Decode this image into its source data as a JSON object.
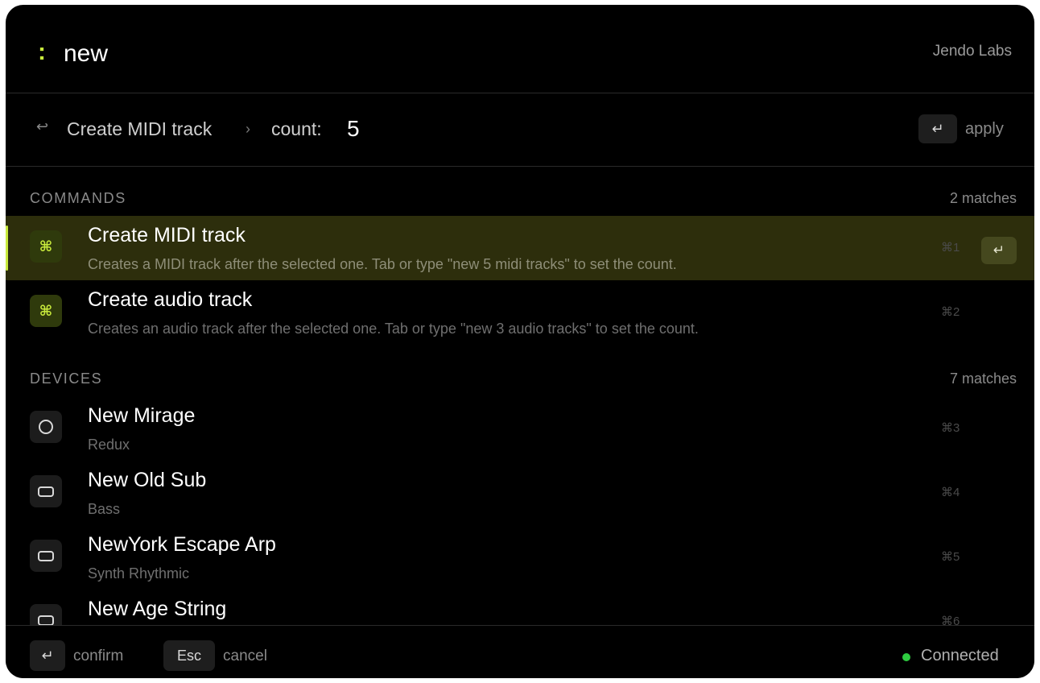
{
  "header": {
    "prompt_symbol": ":",
    "query": "new",
    "brand": "Jendo Labs"
  },
  "argument_bar": {
    "back_icon": "return-arrow-icon",
    "command": "Create MIDI track",
    "separator": "›",
    "label": "count:",
    "value": "5",
    "apply_key": "↵",
    "apply_label": "apply"
  },
  "sections": {
    "commands": {
      "title": "COMMANDS",
      "count": "2 matches",
      "items": [
        {
          "title": "Create MIDI track",
          "subtitle": "Creates a MIDI track after the selected one. Tab or type \"new 5 midi tracks\" to set the count.",
          "icon": "⌘",
          "shortcut": "⌘1",
          "enter_key": "↵"
        },
        {
          "title": "Create audio track",
          "subtitle": "Creates an audio track after the selected one. Tab or type \"new 3 audio tracks\" to set the count.",
          "icon": "⌘",
          "shortcut": "⌘2"
        }
      ]
    },
    "devices": {
      "title": "DEVICES",
      "count": "7 matches",
      "items": [
        {
          "title": "New Mirage",
          "subtitle": "Redux",
          "icon": "circle-device-icon",
          "shortcut": "⌘3"
        },
        {
          "title": "New Old Sub",
          "subtitle": "Bass",
          "icon": "rect-device-icon",
          "shortcut": "⌘4"
        },
        {
          "title": "NewYork Escape Arp",
          "subtitle": "Synth Rhythmic",
          "icon": "rect-device-icon",
          "shortcut": "⌘5"
        },
        {
          "title": "New Age String",
          "subtitle": "",
          "icon": "rect-device-icon",
          "shortcut": "⌘6"
        }
      ]
    }
  },
  "footer": {
    "confirm_key": "↵",
    "confirm_label": "confirm",
    "cancel_key": "Esc",
    "cancel_label": "cancel",
    "status": "Connected",
    "status_color": "#2ecc40"
  },
  "colors": {
    "accent": "#c8ea3c",
    "selected_row": "#2d2e0c",
    "background": "#000000"
  }
}
